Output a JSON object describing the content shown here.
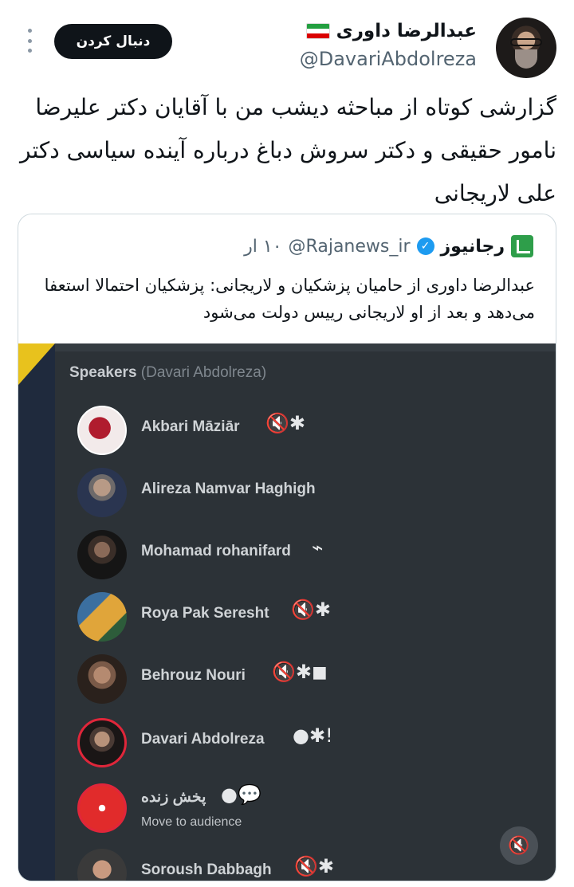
{
  "header": {
    "display_name": "عبدالرضا داوری",
    "handle": "@DavariAbdolreza",
    "follow_label": "دنبال کردن",
    "flag_colors": [
      "#239f40",
      "#ffffff",
      "#da0000"
    ]
  },
  "tweet": {
    "text": "گزارشی کوتاه از مباحثه دیشب من با آقایان دکتر علیرضا نامور حقیقی و دکتر سروش دباغ درباره آینده سیاسی دکتر علی لاریجانی"
  },
  "quote": {
    "name": "رجانیوز",
    "handle": "@Rajanews_ir",
    "time": "۱۰ ار",
    "text": "عبدالرضا داوری از حامیان پزشکیان و لاریجانی: پزشکیان احتمالا استعفا می‌دهد و بعد از او لاریجانی رییس دولت می‌شود",
    "accent_color": "#1d9bf0",
    "media": {
      "speakers_title": "Speakers",
      "speakers_host": "(Davari Abdolreza)",
      "speakers": [
        {
          "name": "Akbari Māziār",
          "icons": "🔇✱",
          "avatar_colors": [
            "#f2eaea",
            "#b01c2e"
          ]
        },
        {
          "name": "Alireza Namvar Haghigh",
          "icons": "",
          "avatar_colors": [
            "#8a7a6e",
            "#2a3550"
          ]
        },
        {
          "name": "Mohamad rohanifard",
          "icons": "⌁",
          "avatar_colors": [
            "#3a2e28",
            "#151515"
          ]
        },
        {
          "name": "Roya Pak Seresht",
          "icons": "🔇✱",
          "avatar_colors": [
            "#e0a53a",
            "#3b6fa0"
          ]
        },
        {
          "name": "Behrouz Nouri",
          "icons": "🔇✱◼",
          "avatar_colors": [
            "#7a5a48",
            "#2a211c"
          ]
        },
        {
          "name": "Davari Abdolreza",
          "icons": "●✱!",
          "avatar_colors": [
            "#b8927a",
            "#1a1616"
          ]
        },
        {
          "name": "پخش زنده",
          "sub": "Move to audience",
          "icons": "●💬",
          "avatar_colors": [
            "#e12b2b",
            "#ffffff"
          ]
        },
        {
          "name": "Soroush Dabbagh",
          "icons": "🔇✱",
          "avatar_colors": [
            "#c99a80",
            "#3a3a3a"
          ]
        }
      ]
    }
  }
}
